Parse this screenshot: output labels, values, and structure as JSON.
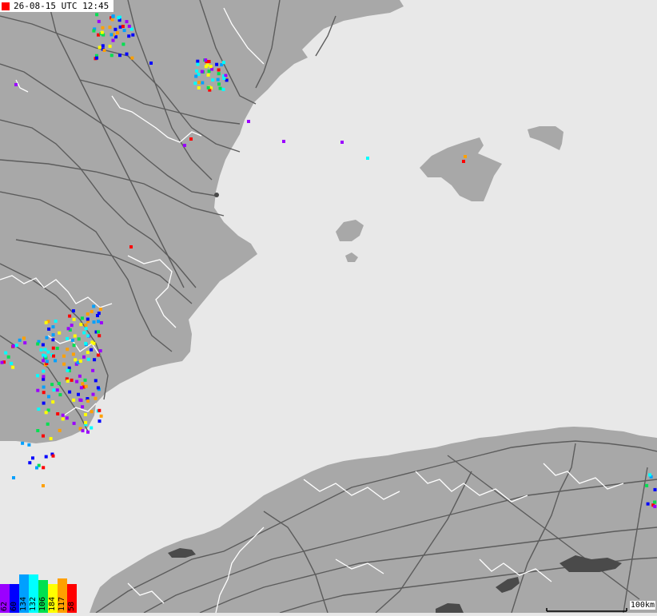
{
  "timestamp": {
    "text": "26-08-15 UTC 12:45",
    "square_color": "#ff0000"
  },
  "legend": {
    "items": [
      {
        "label": "62",
        "color": "#9b00ff",
        "level": 0.75
      },
      {
        "label": "60",
        "color": "#0000ff",
        "level": 0.75
      },
      {
        "label": "134",
        "color": "#00a0ff",
        "level": 1.0
      },
      {
        "label": "132",
        "color": "#00ffff",
        "level": 1.0
      },
      {
        "label": "106",
        "color": "#00e050",
        "level": 0.85
      },
      {
        "label": "184",
        "color": "#ffff00",
        "level": 0.75
      },
      {
        "label": "117",
        "color": "#ffa000",
        "level": 0.9
      },
      {
        "label": "58",
        "color": "#ff0000",
        "level": 0.75
      }
    ]
  },
  "scale": {
    "label": "100km"
  },
  "colors": {
    "sea": "#e8e8e8",
    "land": "#a8a8a8",
    "roads": "#5c5c5c",
    "borders": "#ffffff",
    "lakes": "#4a4a4a"
  }
}
